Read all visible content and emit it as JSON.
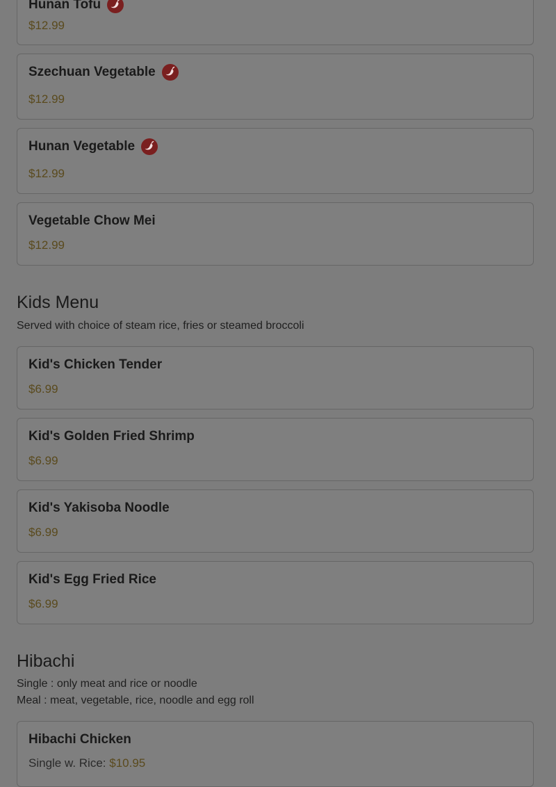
{
  "vegetable_section": {
    "items": [
      {
        "name": "Hunan Tofu",
        "price": "$12.99",
        "spicy": true
      },
      {
        "name": "Szechuan Vegetable",
        "price": "$12.99",
        "spicy": true
      },
      {
        "name": "Hunan Vegetable",
        "price": "$12.99",
        "spicy": true
      },
      {
        "name": "Vegetable Chow Mei",
        "price": "$12.99",
        "spicy": false
      }
    ]
  },
  "kids_section": {
    "title": "Kids Menu",
    "description": "Served with choice of steam rice, fries or steamed broccoli",
    "items": [
      {
        "name": "Kid's Chicken Tender",
        "price": "$6.99"
      },
      {
        "name": "Kid's Golden Fried Shrimp",
        "price": "$6.99"
      },
      {
        "name": "Kid's Yakisoba Noodle",
        "price": "$6.99"
      },
      {
        "name": "Kid's Egg Fried Rice",
        "price": "$6.99"
      }
    ]
  },
  "hibachi_section": {
    "title": "Hibachi",
    "description_line1": "Single : only meat and rice or noodle",
    "description_line2": "Meal : meat, vegetable, rice, noodle and egg roll",
    "items": [
      {
        "name": "Hibachi Chicken",
        "price_label": "Single w. Rice:",
        "price": "$10.95"
      }
    ]
  },
  "colors": {
    "overlay_bg": "#7d7d7d",
    "card_border": "#666666",
    "price": "#5a4a1d",
    "spicy_badge": "#7a1f1f"
  },
  "icons": {
    "spicy": "chili-pepper-icon"
  }
}
